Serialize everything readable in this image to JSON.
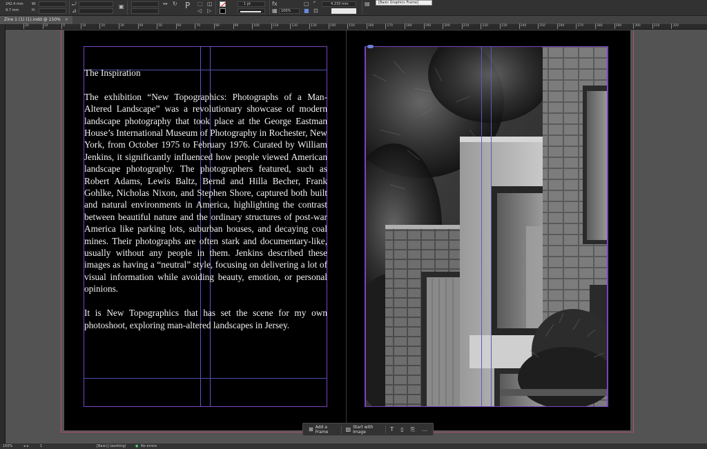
{
  "control_bar": {
    "x_field": "242.4 mm",
    "y_field": "9.7 mm",
    "w_label": "W:",
    "h_label": "H:",
    "stroke_weight": "1 pt",
    "zoom_percent": "100%",
    "size_field": "4.233 mm",
    "frame_style": "[Basic Graphics Frame]"
  },
  "document": {
    "tab_title": "Zine 1 (1) (1).indd @ 150%",
    "close_glyph": "×"
  },
  "ruler": {
    "labels": [
      "20",
      "10",
      "0",
      "10",
      "20",
      "30",
      "40",
      "50",
      "60",
      "70",
      "80",
      "90",
      "100",
      "110",
      "120",
      "130",
      "140",
      "150",
      "160",
      "170",
      "180",
      "190",
      "200",
      "210",
      "220",
      "230",
      "240",
      "250",
      "260",
      "270",
      "280",
      "290",
      "300",
      "310",
      "320"
    ]
  },
  "story": {
    "title": "The Inspiration",
    "paragraph_1": "The exhibition “New Topographics: Photographs of a Man-Altered Landscape” was a revolutionary showcase of modern landscape photography that took place at the George Eastman House’s International Museum of Photography in Rochester, New York, from October 1975 to February 1976. Curated by William Jenkins, it significantly influenced how people viewed American landscape photography. The photographers featured, such as Robert Adams, Lewis Baltz, Bernd and Hilla Becher, Frank Gohlke, Nicholas Nixon, and Stephen Shore, captured both built and natural environments in America, highlighting the contrast between beautiful nature and the ordinary structures of post-war America like parking lots, suburban houses, and decaying coal mines. Their photographs are often stark and documentary-like, usually without any people in them. Jenkins described these images as having a “neutral” style, focusing on delivering a lot of visual information while avoiding beauty, emotion, or personal opinions.",
    "paragraph_2": "It is New Topographics that has set the scene for my own photoshoot, exploring man-altered landscapes in Jersey."
  },
  "task_bar": {
    "add_frame_label": "Add a Frame",
    "start_with_image_label": "Start with Image",
    "more_glyph": "…"
  },
  "status_bar": {
    "zoom": "150%",
    "page": "1",
    "style": "[Basic] (working)",
    "errors": "No errors"
  },
  "colors": {
    "margin_guide": "#7a44c4",
    "column_guide": "#5b58c8",
    "bleed_guide": "#b0506a",
    "pasteboard": "#535353"
  }
}
